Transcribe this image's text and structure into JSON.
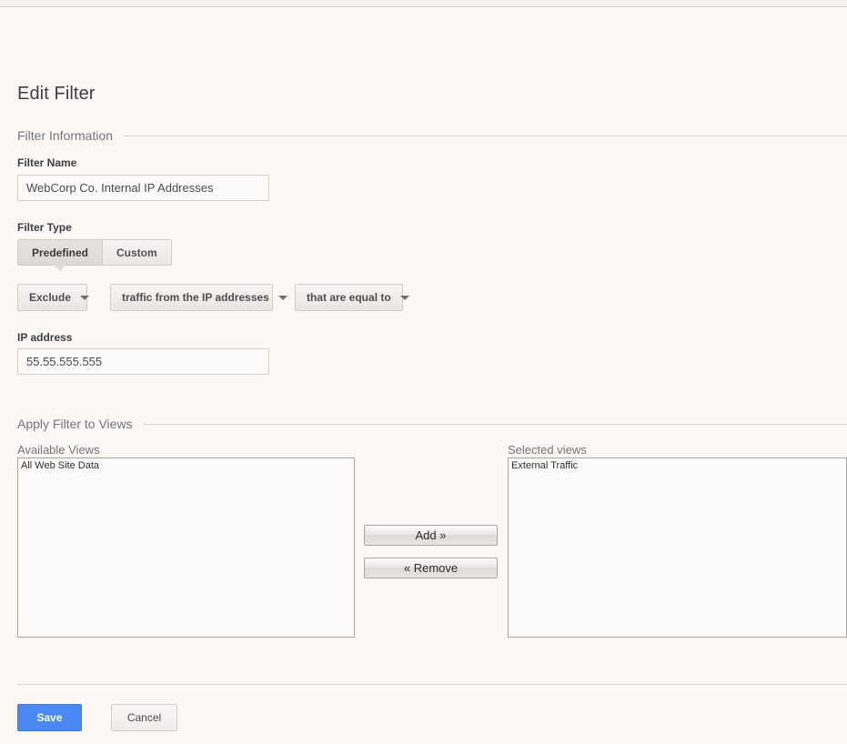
{
  "page": {
    "title": "Edit Filter"
  },
  "sections": {
    "filter_information": "Filter Information",
    "apply_filter_to_views": "Apply Filter to Views"
  },
  "filter_name": {
    "label": "Filter Name",
    "value": "WebCorp Co. Internal IP Addresses",
    "placeholder": ""
  },
  "filter_type": {
    "label": "Filter Type",
    "tabs": [
      {
        "label": "Predefined",
        "selected": true
      },
      {
        "label": "Custom",
        "selected": false
      }
    ],
    "dropdowns": [
      {
        "name": "action",
        "value": "Exclude"
      },
      {
        "name": "field",
        "value": "traffic from the IP addresses"
      },
      {
        "name": "match_type",
        "value": "that are equal to"
      }
    ]
  },
  "ip_address": {
    "label": "IP address",
    "value": "55.55.555.555",
    "placeholder": ""
  },
  "views": {
    "available_label": "Available Views",
    "selected_label": "Selected views",
    "available": [
      "All Web Site Data"
    ],
    "selected": [
      "External Traffic"
    ],
    "add_label": "Add »",
    "remove_label": "« Remove"
  },
  "footer": {
    "save_label": "Save",
    "cancel_label": "Cancel"
  },
  "colors": {
    "page_background": "#fdf7f6",
    "save_button": "#4a89f3",
    "rule": "#d8d2d1",
    "label_muted": "#70757a",
    "text": "#3c4043"
  }
}
